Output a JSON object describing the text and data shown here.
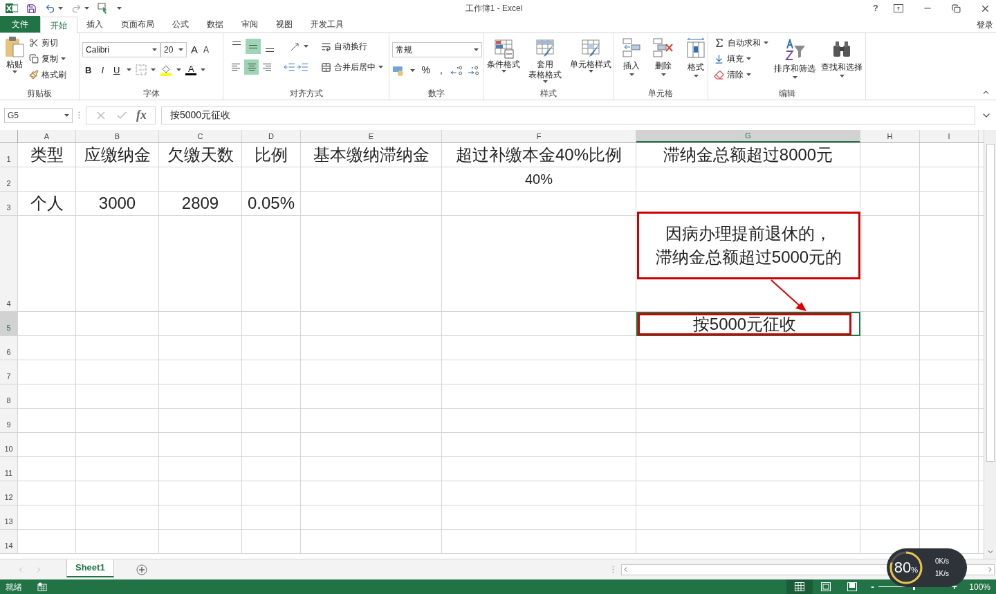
{
  "title_bar": {
    "title": "工作簿1 - Excel",
    "help": "?",
    "sign_in": "登录"
  },
  "ribbon_tabs": [
    {
      "label": "文件",
      "kind": "file",
      "selected": false
    },
    {
      "label": "开始",
      "kind": "tab",
      "selected": true
    },
    {
      "label": "插入",
      "kind": "tab",
      "selected": false
    },
    {
      "label": "页面布局",
      "kind": "tab",
      "selected": false
    },
    {
      "label": "公式",
      "kind": "tab",
      "selected": false
    },
    {
      "label": "数据",
      "kind": "tab",
      "selected": false
    },
    {
      "label": "审阅",
      "kind": "tab",
      "selected": false
    },
    {
      "label": "视图",
      "kind": "tab",
      "selected": false
    },
    {
      "label": "开发工具",
      "kind": "tab",
      "selected": false
    }
  ],
  "ribbon_groups": [
    {
      "kind": "clipboard",
      "label": "剪贴板",
      "large": "粘贴",
      "items": [
        "剪切",
        "复制",
        "格式刷"
      ]
    },
    {
      "kind": "font",
      "label": "字体",
      "font_name": "Calibri",
      "font_size": "20",
      "size_buttons": [
        "A",
        "A"
      ],
      "format_buttons": [
        "B",
        "I",
        "U"
      ],
      "font_color": "A"
    },
    {
      "kind": "alignment",
      "label": "对齐方式",
      "vertical": [
        {
          "kind": "top",
          "selected": false
        },
        {
          "kind": "middle",
          "selected": true
        },
        {
          "kind": "bottom",
          "selected": false
        }
      ],
      "horizontal": [
        {
          "kind": "left",
          "selected": false
        },
        {
          "kind": "center",
          "selected": true
        },
        {
          "kind": "right",
          "selected": false
        }
      ],
      "wrap": "自动换行",
      "merge": "合并后居中"
    },
    {
      "kind": "number",
      "label": "数字",
      "format": "常规",
      "symbols": [
        "%",
        ","
      ]
    },
    {
      "kind": "styles",
      "label": "样式",
      "buttons": [
        {
          "kind": "conditional",
          "lines": [
            "条件格式"
          ]
        },
        {
          "kind": "table",
          "lines": [
            "套用",
            "表格格式"
          ]
        },
        {
          "kind": "cell",
          "lines": [
            "单元格样式"
          ]
        }
      ]
    },
    {
      "kind": "cells",
      "label": "单元格",
      "buttons": [
        {
          "kind": "insert",
          "label": "插入"
        },
        {
          "kind": "delete",
          "label": "删除"
        },
        {
          "kind": "format",
          "label": "格式"
        }
      ]
    },
    {
      "kind": "editing",
      "label": "编辑",
      "small": [
        {
          "kind": "sum",
          "label": "自动求和"
        },
        {
          "kind": "fill",
          "label": "填充"
        },
        {
          "kind": "clear",
          "label": "清除"
        }
      ],
      "large": [
        {
          "kind": "sort",
          "label": "排序和筛选"
        },
        {
          "kind": "find",
          "label": "查找和选择"
        }
      ]
    }
  ],
  "formula_bar": {
    "name_box": "G5",
    "fx": "fx",
    "content": "按5000元征收"
  },
  "sheet": {
    "columns": [
      {
        "label": "A",
        "selected": false
      },
      {
        "label": "B",
        "selected": false
      },
      {
        "label": "C",
        "selected": false
      },
      {
        "label": "D",
        "selected": false
      },
      {
        "label": "E",
        "selected": false
      },
      {
        "label": "F",
        "selected": false
      },
      {
        "label": "G",
        "selected": true
      },
      {
        "label": "H",
        "selected": false
      },
      {
        "label": "I",
        "selected": false
      }
    ],
    "rows": [
      {
        "label": "1",
        "selected": false,
        "cells": [
          {
            "text": "类型"
          },
          {
            "text": "应缴纳金"
          },
          {
            "text": "欠缴天数"
          },
          {
            "text": "比例"
          },
          {
            "text": "基本缴纳滞纳金"
          },
          {
            "text": "超过补缴本金40%比例"
          },
          {
            "text": "滞纳金总额超过8000元"
          },
          null,
          null
        ]
      },
      {
        "label": "2",
        "selected": false,
        "cells": [
          null,
          null,
          null,
          null,
          null,
          {
            "text": "40%"
          },
          null,
          null,
          null
        ]
      },
      {
        "label": "3",
        "selected": false,
        "cells": [
          {
            "text": "个人"
          },
          {
            "text": "3000"
          },
          {
            "text": "2809"
          },
          {
            "text": "0.05%"
          },
          null,
          null,
          null,
          null,
          null
        ]
      },
      {
        "label": "4",
        "selected": false,
        "cells": []
      },
      {
        "label": "5",
        "selected": true,
        "cells": [
          null,
          null,
          null,
          null,
          null,
          null,
          {
            "text": "按5000元征收",
            "boxed": true,
            "selected": true
          },
          null,
          null
        ]
      },
      {
        "label": "6",
        "selected": false,
        "cells": []
      },
      {
        "label": "7",
        "selected": false,
        "cells": []
      },
      {
        "label": "8",
        "selected": false,
        "cells": []
      },
      {
        "label": "9",
        "selected": false,
        "cells": []
      },
      {
        "label": "10",
        "selected": false,
        "cells": []
      },
      {
        "label": "11",
        "selected": false,
        "cells": []
      },
      {
        "label": "12",
        "selected": false,
        "cells": []
      },
      {
        "label": "13",
        "selected": false,
        "cells": []
      },
      {
        "label": "14",
        "selected": false,
        "cells": []
      }
    ],
    "callout": {
      "lines": [
        "因病办理提前退休的，",
        "滞纳金总额超过5000元的"
      ]
    }
  },
  "sheet_tabs": [
    {
      "label": "Sheet1",
      "selected": true
    }
  ],
  "status_bar": {
    "status": "就绪",
    "views": [
      {
        "kind": "normal",
        "selected": true
      },
      {
        "kind": "page_layout",
        "selected": false
      },
      {
        "kind": "page_break",
        "selected": false
      }
    ],
    "zoom_out": "-",
    "zoom_in": "+",
    "level": 0.5,
    "zoom": "100%"
  },
  "net_widget": {
    "percent": "80",
    "unit": "%",
    "up": "0K/s",
    "down": "1K/s"
  }
}
